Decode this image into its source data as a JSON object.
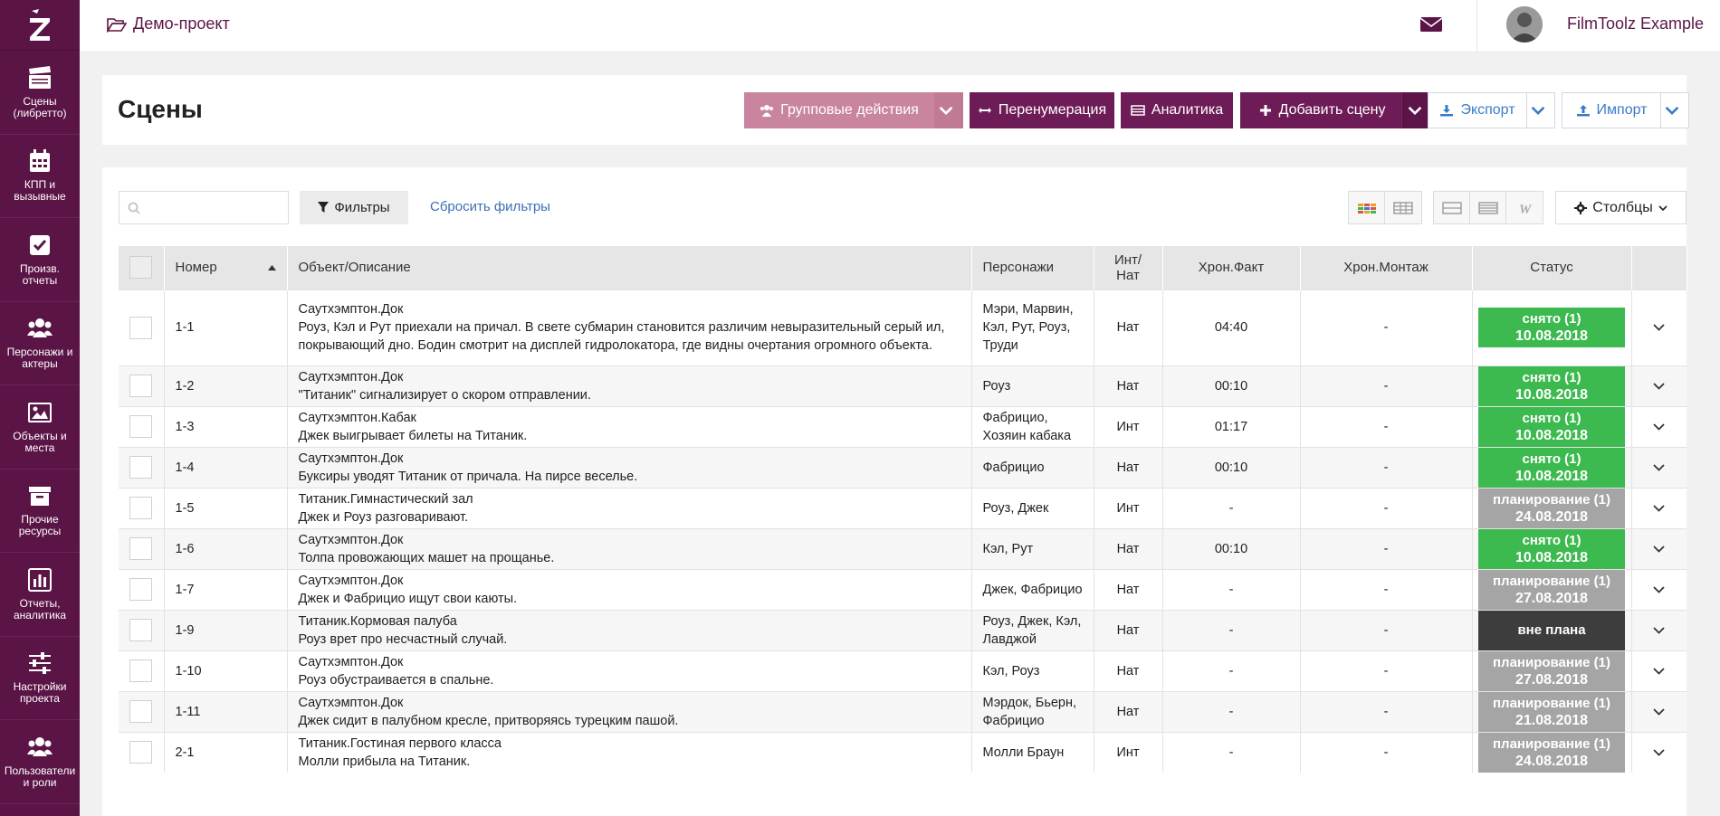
{
  "sidebar": {
    "items": [
      {
        "label": "Сцены (либретто)",
        "icon": "clapperboard-icon"
      },
      {
        "label": "КПП и вызывные",
        "icon": "calendar-icon"
      },
      {
        "label": "Произв. отчеты",
        "icon": "checkbox-icon"
      },
      {
        "label": "Персонажи и актеры",
        "icon": "users-icon"
      },
      {
        "label": "Объекты и места",
        "icon": "image-icon"
      },
      {
        "label": "Прочие ресурсы",
        "icon": "archive-icon"
      },
      {
        "label": "Отчеты, аналитика",
        "icon": "bar-chart-icon"
      },
      {
        "label": "Настройки проекта",
        "icon": "sliders-icon"
      },
      {
        "label": "Пользователи и роли",
        "icon": "users-icon"
      }
    ]
  },
  "topbar": {
    "project": "Демо-проект",
    "user": "FilmToolz Example"
  },
  "header": {
    "title": "Сцены",
    "group_actions": "Групповые действия",
    "renumber": "Перенумерация",
    "analytics": "Аналитика",
    "add_scene": "Добавить сцену",
    "export": "Экспорт",
    "import": "Импорт"
  },
  "toolbar": {
    "search_placeholder": "",
    "filters": "Фильтры",
    "reset_filters": "Сбросить фильтры",
    "columns": "Столбцы"
  },
  "table": {
    "columns": [
      "Номер",
      "Объект/Описание",
      "Персонажи",
      "Инт/Нат",
      "Хрон.Факт",
      "Хрон.Монтаж",
      "Статус"
    ],
    "rows": [
      {
        "num": "1-1",
        "place": "Саутхэмптон.Док",
        "desc": "Роуз, Кэл и Рут приехали на причал. В свете субмарин становится различим невыразительный серый ил, покрывающий дно. Бодин смотрит на дисплей гидролокатора, где видны очертания огромного объекта.",
        "chars": "Мэри, Марвин, Кэл, Рут, Роуз, Труди",
        "intnat": "Нат",
        "fact": "04:40",
        "mont": "-",
        "status": "снято (1)",
        "date": "10.08.2018",
        "kind": "green"
      },
      {
        "num": "1-2",
        "place": "Саутхэмптон.Док",
        "desc": "\"Титаник\" сигнализирует о скором отправлении.",
        "chars": "Роуз",
        "intnat": "Нат",
        "fact": "00:10",
        "mont": "-",
        "status": "снято (1)",
        "date": "10.08.2018",
        "kind": "green"
      },
      {
        "num": "1-3",
        "place": "Саутхэмптон.Кабак",
        "desc": "Джек выигрывает билеты на Титаник.",
        "chars": "Фабрицио, Хозяин кабака",
        "intnat": "Инт",
        "fact": "01:17",
        "mont": "-",
        "status": "снято (1)",
        "date": "10.08.2018",
        "kind": "green"
      },
      {
        "num": "1-4",
        "place": "Саутхэмптон.Док",
        "desc": "Буксиры уводят Титаник от причала. На пирсе веселье.",
        "chars": "Фабрицио",
        "intnat": "Нат",
        "fact": "00:10",
        "mont": "-",
        "status": "снято (1)",
        "date": "10.08.2018",
        "kind": "green"
      },
      {
        "num": "1-5",
        "place": "Титаник.Гимнастический зал",
        "desc": "Джек и Роуз разговаривают.",
        "chars": "Роуз, Джек",
        "intnat": "Инт",
        "fact": "-",
        "mont": "-",
        "status": "планирование (1)",
        "date": "24.08.2018",
        "kind": "gray"
      },
      {
        "num": "1-6",
        "place": "Саутхэмптон.Док",
        "desc": "Толпа провожающих машет на прощанье.",
        "chars": "Кэл, Рут",
        "intnat": "Нат",
        "fact": "00:10",
        "mont": "-",
        "status": "снято (1)",
        "date": "10.08.2018",
        "kind": "green"
      },
      {
        "num": "1-7",
        "place": "Саутхэмптон.Док",
        "desc": "Джек и Фабрицио ищут свои каюты.",
        "chars": "Джек, Фабрицио",
        "intnat": "Нат",
        "fact": "-",
        "mont": "-",
        "status": "планирование (1)",
        "date": "27.08.2018",
        "kind": "gray"
      },
      {
        "num": "1-9",
        "place": "Титаник.Кормовая палуба",
        "desc": "Роуз врет про несчастный случай.",
        "chars": "Роуз, Джек, Кэл, Лавджой",
        "intnat": "Нат",
        "fact": "-",
        "mont": "-",
        "status": "вне плана",
        "date": "",
        "kind": "dark"
      },
      {
        "num": "1-10",
        "place": "Саутхэмптон.Док",
        "desc": "Роуз обустраивается в спальне.",
        "chars": "Кэл, Роуз",
        "intnat": "Нат",
        "fact": "-",
        "mont": "-",
        "status": "планирование (1)",
        "date": "27.08.2018",
        "kind": "gray"
      },
      {
        "num": "1-11",
        "place": "Саутхэмптон.Док",
        "desc": "Джек сидит в палубном кресле, притворяясь турецким пашой.",
        "chars": "Мэрдок, Бьерн, Фабрицио",
        "intnat": "Нат",
        "fact": "-",
        "mont": "-",
        "status": "планирование (1)",
        "date": "21.08.2018",
        "kind": "gray"
      },
      {
        "num": "2-1",
        "place": "Титаник.Гостиная первого класса",
        "desc": "Молли прибыла на Титаник.",
        "chars": "Молли Браун",
        "intnat": "Инт",
        "fact": "-",
        "mont": "-",
        "status": "планирование (1)",
        "date": "24.08.2018",
        "kind": "gray"
      }
    ]
  },
  "colors": {
    "sidebar": "#5b1446",
    "accent": "#6e1c58",
    "status_green": "#3dba4f",
    "status_gray": "#a5a5a5",
    "status_dark": "#3d3d3d",
    "link": "#3a6fb5"
  }
}
